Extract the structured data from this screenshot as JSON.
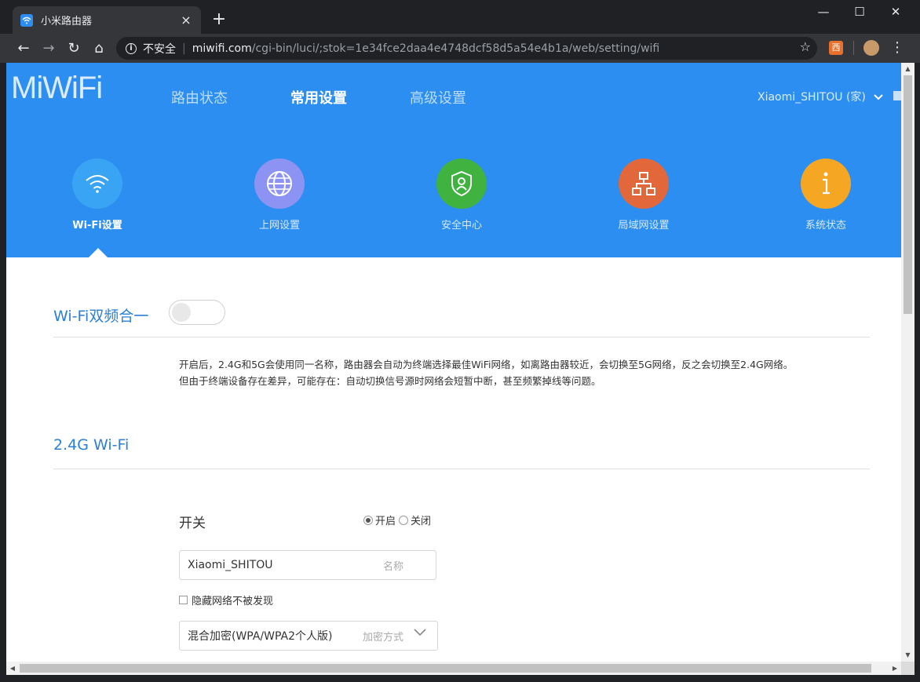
{
  "browser": {
    "tab_title": "小米路由器",
    "tab_close": "×",
    "new_tab": "+",
    "win_min": "—",
    "win_max": "☐",
    "win_close": "✕",
    "insecure_label": "不安全",
    "url_host": "miwifi.com",
    "url_path": "/cgi-bin/luci/;stok=1e34fce2daa4e4748dcf58d5a54e4b1a/web/setting/wifi",
    "ext_label": "西"
  },
  "header": {
    "logo": "MiWiFi",
    "nav": [
      "路由状态",
      "常用设置",
      "高级设置"
    ],
    "active_nav": "常用设置",
    "user": "Xiaomi_SHITOU (家)"
  },
  "categories": [
    {
      "label": "Wi-Fi设置",
      "icon": "wifi-icon",
      "color": "#3aa4f4",
      "active": true
    },
    {
      "label": "上网设置",
      "icon": "globe-icon",
      "color": "#8d93f2",
      "active": false
    },
    {
      "label": "安全中心",
      "icon": "shield-icon",
      "color": "#3fb23f",
      "active": false
    },
    {
      "label": "局域网设置",
      "icon": "lan-icon",
      "color": "#e2683c",
      "active": false
    },
    {
      "label": "系统状态",
      "icon": "info-icon",
      "color": "#f5a623",
      "active": false
    }
  ],
  "dual_band": {
    "title": "Wi-Fi双频合一",
    "enabled": false,
    "desc_line1": "开启后，2.4G和5G会使用同一名称，路由器会自动为终端选择最佳WiFi网络，如离路由器较近，会切换至5G网络，反之会切换至2.4G网络。",
    "desc_line2": "但由于终端设备存在差异，可能存在：自动切换信号源时网络会短暂中断，甚至频繁掉线等问题。"
  },
  "wifi24": {
    "title": "2.4G Wi-Fi",
    "switch_label": "开关",
    "on_label": "开启",
    "off_label": "关闭",
    "switch_value": "on",
    "ssid_value": "Xiaomi_SHITOU",
    "ssid_hint": "名称",
    "hide_label": "隐藏网络不被发现",
    "encryption_value": "混合加密(WPA/WPA2个人版)",
    "encryption_hint": "加密方式"
  }
}
